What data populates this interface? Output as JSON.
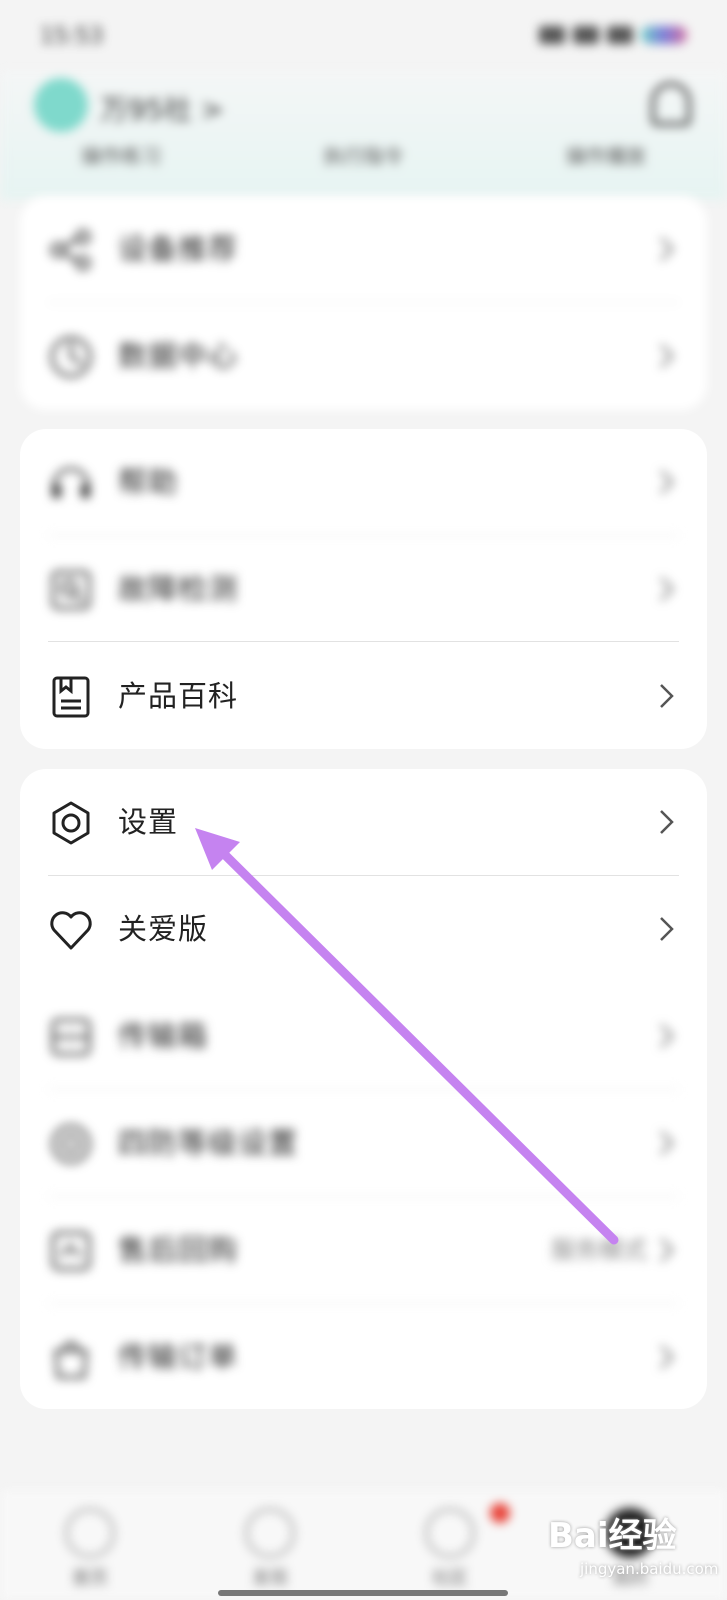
{
  "status_bar": {
    "time": "15:53"
  },
  "header": {
    "username": "万95社 >",
    "stats": [
      "操作练习",
      "执行指令",
      "操作播放"
    ]
  },
  "menu": {
    "group1": [
      "设备推荐",
      "数据中心"
    ],
    "group2": [
      "帮助",
      "故障检测",
      "产品百科"
    ],
    "group3": [
      "设置",
      "关爱版",
      "传输箱",
      "四防等级设置",
      "售后回购",
      "传输订单"
    ],
    "backup_value": "服务模式"
  },
  "tabs": [
    "首页",
    "发现",
    "社区",
    "我的"
  ],
  "watermark": {
    "brand": "Bai经验",
    "url": "jingyan.baidu.com"
  },
  "annotation": {
    "color": "#c583f0"
  }
}
